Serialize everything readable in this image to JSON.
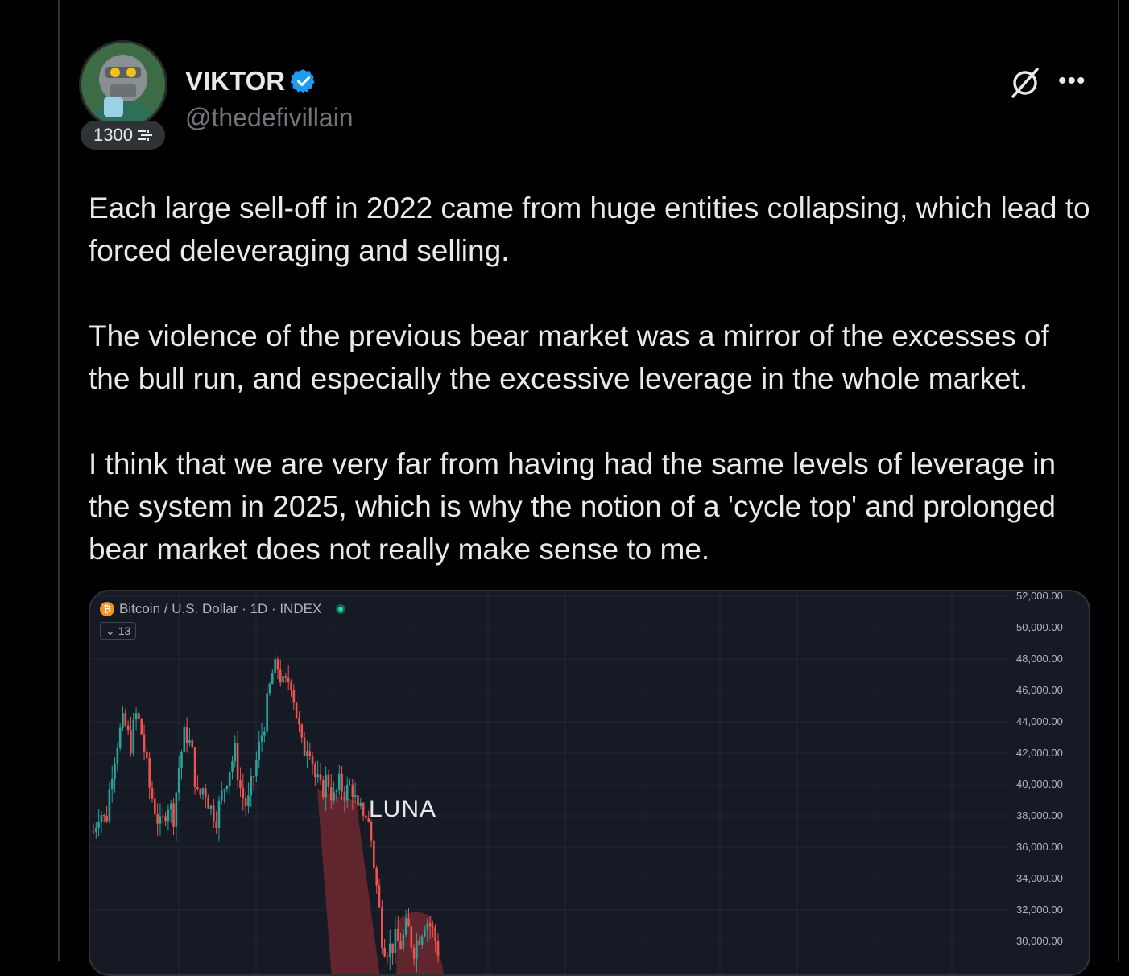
{
  "author": {
    "name": "VIKTOR",
    "handle": "@thedefivillain",
    "count_badge": "1300",
    "verified": true,
    "avatar_icon": "masked-villain-avatar"
  },
  "actions": {
    "grok_icon": "grok-icon",
    "more_icon": "more-icon"
  },
  "tweet": {
    "paragraphs": [
      "Each large sell-off in 2022 came from huge entities collapsing, which lead to forced deleveraging and selling.",
      "The violence of the previous bear market was a mirror of the excesses of the bull run, and especially the excessive leverage in the whole market.",
      "I think that we are very far from having had the same levels of leverage in the system in 2025, which is why the notion of a 'cycle top' and prolonged bear market does not really make sense to me."
    ]
  },
  "chart": {
    "symbol": "Bitcoin / U.S. Dollar · 1D · INDEX",
    "interval_badge": "13",
    "annotation": "LUNA",
    "y_tick_labels": [
      "52,000.00",
      "50,000.00",
      "48,000.00",
      "46,000.00",
      "44,000.00",
      "42,000.00",
      "40,000.00",
      "38,000.00",
      "36,000.00",
      "34,000.00",
      "32,000.00",
      "30,000.00"
    ],
    "colors": {
      "up": "#26a69a",
      "down": "#ef5350",
      "background": "#161a25",
      "highlight": "#7a2a30"
    }
  },
  "chart_data": {
    "type": "candlestick",
    "title": "Bitcoin / U.S. Dollar · 1D · INDEX",
    "ylim": [
      29000,
      52000
    ],
    "y_ticks": [
      52000,
      50000,
      48000,
      46000,
      44000,
      42000,
      40000,
      38000,
      36000,
      34000,
      32000,
      30000
    ],
    "annotations": [
      "LUNA"
    ],
    "close_path": [
      37000,
      38500,
      37500,
      41000,
      43000,
      44000,
      42500,
      44500,
      43000,
      40000,
      38500,
      37000,
      39000,
      38000,
      41500,
      43500,
      42000,
      39000,
      40000,
      38500,
      38000,
      39500,
      41000,
      42000,
      39500,
      38500,
      40500,
      42500,
      44500,
      47000,
      47500,
      46000,
      47000,
      44500,
      42000,
      43000,
      40500,
      39500,
      40500,
      39000,
      40000,
      39500,
      40000,
      38000,
      38500,
      37000,
      33500,
      30000,
      29500,
      30000,
      29800,
      31000,
      29500,
      30500,
      31500,
      30800,
      29500
    ]
  }
}
